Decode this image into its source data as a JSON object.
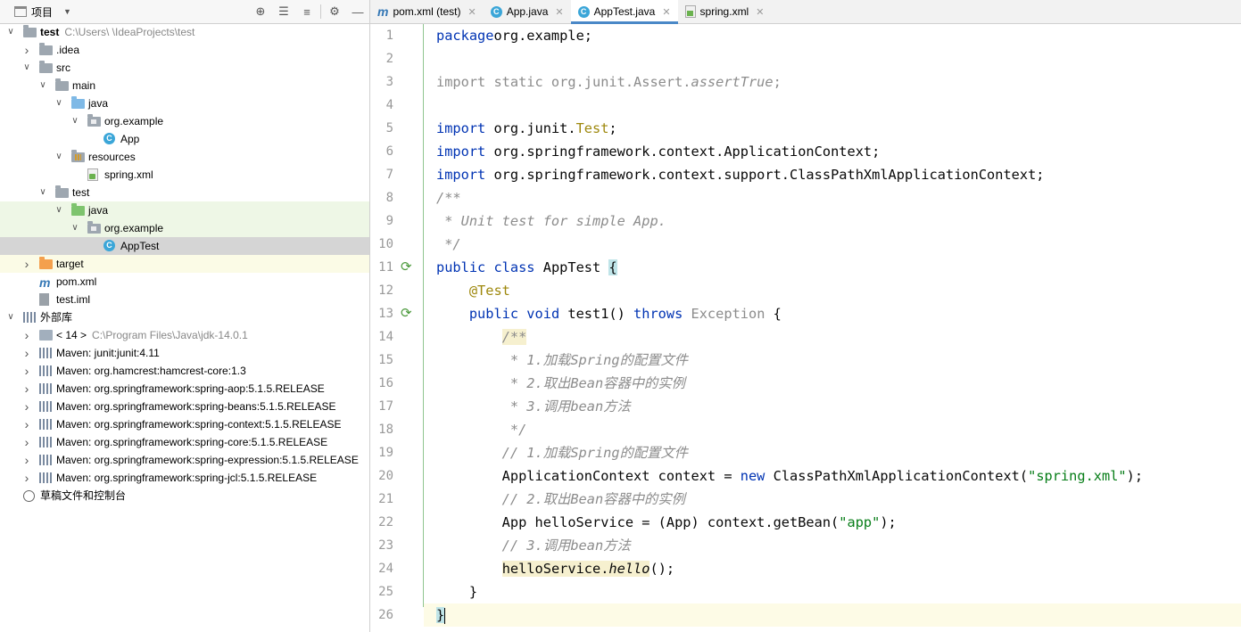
{
  "project": {
    "header": {
      "title": "项目"
    },
    "tree": [
      {
        "depth": 0,
        "arrow": "down",
        "icon": "module-folder",
        "label": "test",
        "bold": true,
        "path": "C:\\Users\\     \\IdeaProjects\\test"
      },
      {
        "depth": 1,
        "arrow": "right",
        "icon": "folder",
        "label": ".idea"
      },
      {
        "depth": 1,
        "arrow": "down",
        "icon": "folder",
        "label": "src"
      },
      {
        "depth": 2,
        "arrow": "down",
        "icon": "folder",
        "label": "main"
      },
      {
        "depth": 3,
        "arrow": "down",
        "icon": "folder-blue",
        "label": "java"
      },
      {
        "depth": 4,
        "arrow": "down",
        "icon": "package",
        "label": "org.example"
      },
      {
        "depth": 5,
        "arrow": "",
        "icon": "class",
        "label": "App"
      },
      {
        "depth": 3,
        "arrow": "down",
        "icon": "resources",
        "label": "resources"
      },
      {
        "depth": 4,
        "arrow": "",
        "icon": "xml",
        "label": "spring.xml"
      },
      {
        "depth": 2,
        "arrow": "down",
        "icon": "folder",
        "label": "test"
      },
      {
        "depth": 3,
        "arrow": "down",
        "icon": "folder-green",
        "label": "java",
        "band": "green"
      },
      {
        "depth": 4,
        "arrow": "down",
        "icon": "package",
        "label": "org.example",
        "band": "green"
      },
      {
        "depth": 5,
        "arrow": "",
        "icon": "class",
        "label": "AppTest",
        "band": "selected"
      },
      {
        "depth": 1,
        "arrow": "right",
        "icon": "folder-orange",
        "label": "target",
        "band": "yellow"
      },
      {
        "depth": 1,
        "arrow": "",
        "icon": "maven",
        "label": "pom.xml"
      },
      {
        "depth": 1,
        "arrow": "",
        "icon": "iml",
        "label": "test.iml"
      },
      {
        "depth": 0,
        "arrow": "down",
        "icon": "library",
        "label": "外部库"
      },
      {
        "depth": 1,
        "arrow": "right",
        "icon": "jdk",
        "label": "< 14 >",
        "path": "C:\\Program Files\\Java\\jdk-14.0.1"
      },
      {
        "depth": 1,
        "arrow": "right",
        "icon": "library",
        "label": "Maven: junit:junit:4.11"
      },
      {
        "depth": 1,
        "arrow": "right",
        "icon": "library",
        "label": "Maven: org.hamcrest:hamcrest-core:1.3"
      },
      {
        "depth": 1,
        "arrow": "right",
        "icon": "library",
        "label": "Maven: org.springframework:spring-aop:5.1.5.RELEASE"
      },
      {
        "depth": 1,
        "arrow": "right",
        "icon": "library",
        "label": "Maven: org.springframework:spring-beans:5.1.5.RELEASE"
      },
      {
        "depth": 1,
        "arrow": "right",
        "icon": "library",
        "label": "Maven: org.springframework:spring-context:5.1.5.RELEASE"
      },
      {
        "depth": 1,
        "arrow": "right",
        "icon": "library",
        "label": "Maven: org.springframework:spring-core:5.1.5.RELEASE"
      },
      {
        "depth": 1,
        "arrow": "right",
        "icon": "library",
        "label": "Maven: org.springframework:spring-expression:5.1.5.RELEASE"
      },
      {
        "depth": 1,
        "arrow": "right",
        "icon": "library",
        "label": "Maven: org.springframework:spring-jcl:5.1.5.RELEASE"
      },
      {
        "depth": 0,
        "arrow": "",
        "icon": "scratch",
        "label": "草稿文件和控制台"
      }
    ]
  },
  "tabs": [
    {
      "icon": "maven",
      "label": "pom.xml (test)",
      "active": false
    },
    {
      "icon": "class",
      "label": "App.java",
      "active": false
    },
    {
      "icon": "class",
      "label": "AppTest.java",
      "active": true
    },
    {
      "icon": "xml",
      "label": "spring.xml",
      "active": false
    }
  ],
  "editor": {
    "run_icon_lines": [
      11,
      13
    ],
    "lines": [
      [
        [
          "kw",
          "package"
        ],
        [
          "",
          "org.example;"
        ]
      ],
      [],
      [
        [
          "gray",
          "import static org.junit.Assert."
        ],
        [
          "gray meth",
          "assertTrue"
        ],
        [
          "gray",
          ";"
        ]
      ],
      [],
      [
        [
          "kw",
          "import"
        ],
        [
          "",
          " org.junit."
        ],
        [
          "ann",
          "Test"
        ],
        [
          "",
          ";"
        ]
      ],
      [
        [
          "kw",
          "import"
        ],
        [
          "",
          " org.springframework.context.ApplicationContext;"
        ]
      ],
      [
        [
          "kw",
          "import"
        ],
        [
          "",
          " org.springframework.context.support.ClassPathXmlApplicationContext;"
        ]
      ],
      [
        [
          "com",
          "/**"
        ]
      ],
      [
        [
          "com",
          " * Unit test for simple App."
        ]
      ],
      [
        [
          "com",
          " */"
        ]
      ],
      [
        [
          "kw",
          "public class "
        ],
        [
          "",
          "AppTest "
        ],
        [
          "hl-brace",
          "{"
        ]
      ],
      [
        [
          "",
          "    "
        ],
        [
          "ann",
          "@Test"
        ]
      ],
      [
        [
          "",
          "    "
        ],
        [
          "kw",
          "public void "
        ],
        [
          "",
          "test1() "
        ],
        [
          "kw",
          "throws "
        ],
        [
          "gray",
          "Exception "
        ],
        [
          "",
          "{"
        ]
      ],
      [
        [
          "",
          "        "
        ],
        [
          "com hl-yellow",
          "/**"
        ]
      ],
      [
        [
          "com",
          "         * 1.加载Spring的配置文件"
        ]
      ],
      [
        [
          "com",
          "         * 2.取出Bean容器中的实例"
        ]
      ],
      [
        [
          "com",
          "         * 3.调用bean方法"
        ]
      ],
      [
        [
          "com",
          "         */"
        ]
      ],
      [
        [
          "com",
          "        // 1.加载Spring的配置文件"
        ]
      ],
      [
        [
          "",
          "        ApplicationContext context = "
        ],
        [
          "kw",
          "new "
        ],
        [
          "",
          "ClassPathXmlApplicationContext("
        ],
        [
          "str",
          "\"spring.xml\""
        ],
        [
          "",
          ");"
        ]
      ],
      [
        [
          "com",
          "        // 2.取出Bean容器中的实例"
        ]
      ],
      [
        [
          "",
          "        App helloService = (App) context.getBean("
        ],
        [
          "str",
          "\"app\""
        ],
        [
          "",
          ");"
        ]
      ],
      [
        [
          "com",
          "        // 3.调用bean方法"
        ]
      ],
      [
        [
          "",
          "        "
        ],
        [
          "hl-yellow",
          "helloService."
        ],
        [
          "hl-yellow meth",
          "hello"
        ],
        [
          "",
          "();"
        ]
      ],
      [
        [
          "",
          "    }"
        ]
      ],
      [
        [
          "hl-brace",
          "}"
        ]
      ]
    ]
  }
}
